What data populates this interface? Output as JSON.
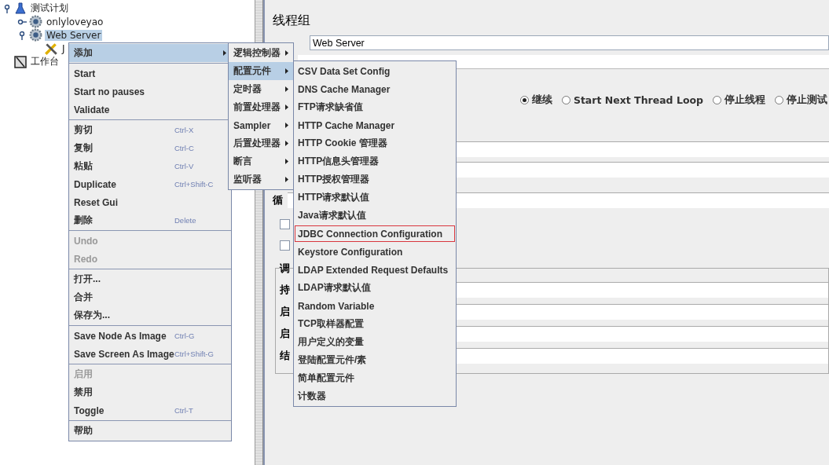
{
  "tree": [
    {
      "label": "测试计划",
      "kind": "plan",
      "expanded": true,
      "selected": false,
      "children": [
        {
          "label": "onlyloveyao",
          "kind": "thread_group",
          "expanded": false,
          "selected": false
        },
        {
          "label": "Web Server",
          "kind": "thread_group",
          "expanded": true,
          "selected": true,
          "children": [
            {
              "label": "J",
              "kind": "element",
              "selected": false
            }
          ]
        }
      ]
    },
    {
      "label": "工作台",
      "kind": "workbench",
      "selected": false
    }
  ],
  "panel": {
    "title": "线程组",
    "name_value": "Web Server",
    "on_error_options": [
      {
        "label": "继续",
        "selected": true
      },
      {
        "label": "Start Next Thread Loop",
        "selected": false
      },
      {
        "label": "停止线程",
        "selected": false
      },
      {
        "label": "停止测试",
        "selected": false
      }
    ],
    "loop_label": "循",
    "checkboxes": [
      {
        "checked": false
      },
      {
        "checked": false
      }
    ],
    "scheduler": {
      "title": "调",
      "field_labels": [
        "持",
        "启",
        "启",
        "结"
      ]
    }
  },
  "context_menu": {
    "sections": [
      [
        {
          "label": "添加",
          "selected": true,
          "disabled": false,
          "submenu": true
        }
      ],
      [
        {
          "label": "Start",
          "selected": false,
          "disabled": false,
          "submenu": false
        },
        {
          "label": "Start no pauses",
          "selected": false,
          "disabled": false,
          "submenu": false
        },
        {
          "label": "Validate",
          "selected": false,
          "disabled": false,
          "submenu": false
        }
      ],
      [
        {
          "label": "剪切",
          "shortcut": "Ctrl-X",
          "selected": false,
          "disabled": false,
          "submenu": false
        },
        {
          "label": "复制",
          "shortcut": "Ctrl-C",
          "selected": false,
          "disabled": false,
          "submenu": false
        },
        {
          "label": "粘贴",
          "shortcut": "Ctrl-V",
          "selected": false,
          "disabled": false,
          "submenu": false
        },
        {
          "label": "Duplicate",
          "shortcut": "Ctrl+Shift-C",
          "selected": false,
          "disabled": false,
          "submenu": false
        },
        {
          "label": "Reset Gui",
          "selected": false,
          "disabled": false,
          "submenu": false
        },
        {
          "label": "删除",
          "shortcut": "Delete",
          "selected": false,
          "disabled": false,
          "submenu": false
        }
      ],
      [
        {
          "label": "Undo",
          "selected": false,
          "disabled": true,
          "submenu": false
        },
        {
          "label": "Redo",
          "selected": false,
          "disabled": true,
          "submenu": false
        }
      ],
      [
        {
          "label": "打开...",
          "selected": false,
          "disabled": false,
          "submenu": false
        },
        {
          "label": "合并",
          "selected": false,
          "disabled": false,
          "submenu": false
        },
        {
          "label": "保存为...",
          "selected": false,
          "disabled": false,
          "submenu": false
        }
      ],
      [
        {
          "label": "Save Node As Image",
          "shortcut": "Ctrl-G",
          "selected": false,
          "disabled": false,
          "submenu": false
        },
        {
          "label": "Save Screen As Image",
          "shortcut": "Ctrl+Shift-G",
          "selected": false,
          "disabled": false,
          "submenu": false
        }
      ],
      [
        {
          "label": "启用",
          "selected": false,
          "disabled": true,
          "submenu": false
        },
        {
          "label": "禁用",
          "selected": false,
          "disabled": false,
          "submenu": false
        },
        {
          "label": "Toggle",
          "shortcut": "Ctrl-T",
          "selected": false,
          "disabled": false,
          "submenu": false
        }
      ],
      [
        {
          "label": "帮助",
          "selected": false,
          "disabled": false,
          "submenu": false
        }
      ]
    ]
  },
  "add_submenu": [
    {
      "label": "逻辑控制器",
      "selected": false,
      "submenu": true
    },
    {
      "label": "配置元件",
      "selected": true,
      "submenu": true
    },
    {
      "label": "定时器",
      "selected": false,
      "submenu": true
    },
    {
      "label": "前置处理器",
      "selected": false,
      "submenu": true
    },
    {
      "label": "Sampler",
      "selected": false,
      "submenu": true
    },
    {
      "label": "后置处理器",
      "selected": false,
      "submenu": true
    },
    {
      "label": "断言",
      "selected": false,
      "submenu": true
    },
    {
      "label": "监听器",
      "selected": false,
      "submenu": true
    }
  ],
  "config_submenu": [
    {
      "label": "CSV Data Set Config",
      "selected": false,
      "marked": false
    },
    {
      "label": "DNS Cache Manager",
      "selected": false,
      "marked": false
    },
    {
      "label": "FTP请求缺省值",
      "selected": false,
      "marked": false
    },
    {
      "label": "HTTP Cache Manager",
      "selected": false,
      "marked": false
    },
    {
      "label": "HTTP Cookie 管理器",
      "selected": false,
      "marked": false
    },
    {
      "label": "HTTP信息头管理器",
      "selected": false,
      "marked": false
    },
    {
      "label": "HTTP授权管理器",
      "selected": false,
      "marked": false
    },
    {
      "label": "HTTP请求默认值",
      "selected": false,
      "marked": false
    },
    {
      "label": "Java请求默认值",
      "selected": false,
      "marked": false
    },
    {
      "label": "JDBC Connection Configuration",
      "selected": false,
      "marked": true
    },
    {
      "label": "Keystore Configuration",
      "selected": false,
      "marked": false
    },
    {
      "label": "LDAP Extended Request Defaults",
      "selected": false,
      "marked": false
    },
    {
      "label": "LDAP请求默认值",
      "selected": false,
      "marked": false
    },
    {
      "label": "Random Variable",
      "selected": false,
      "marked": false
    },
    {
      "label": "TCP取样器配置",
      "selected": false,
      "marked": false
    },
    {
      "label": "用户定义的变量",
      "selected": false,
      "marked": false
    },
    {
      "label": "登陆配置元件/素",
      "selected": false,
      "marked": false
    },
    {
      "label": "简单配置元件",
      "selected": false,
      "marked": false
    },
    {
      "label": "计数器",
      "selected": false,
      "marked": false
    }
  ]
}
